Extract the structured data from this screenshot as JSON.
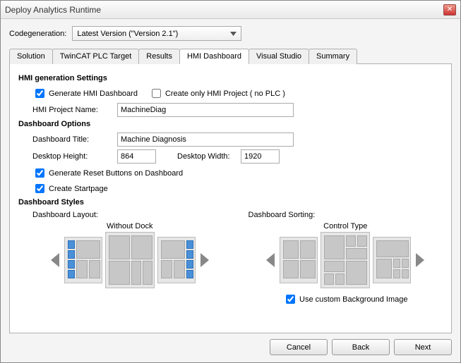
{
  "window": {
    "title": "Deploy Analytics Runtime"
  },
  "codegen": {
    "label": "Codegeneration:",
    "selected": "Latest Version (\"Version 2.1\")"
  },
  "tabs": {
    "items": [
      "Solution",
      "TwinCAT PLC Target",
      "Results",
      "HMI Dashboard",
      "Visual Studio",
      "Summary"
    ],
    "active_index": 3
  },
  "hmi_settings": {
    "heading": "HMI generation Settings",
    "generate_dashboard": {
      "label": "Generate HMI Dashboard",
      "checked": true
    },
    "create_only": {
      "label": "Create only HMI Project ( no PLC )",
      "checked": false
    },
    "project_name": {
      "label": "HMI Project Name:",
      "value": "MachineDiag"
    }
  },
  "dashboard_options": {
    "heading": "Dashboard Options",
    "title": {
      "label": "Dashboard Title:",
      "value": "Machine Diagnosis"
    },
    "height": {
      "label": "Desktop Height:",
      "value": "864"
    },
    "width": {
      "label": "Desktop Width:",
      "value": "1920"
    },
    "reset_buttons": {
      "label": "Generate Reset Buttons on Dashboard",
      "checked": true
    },
    "startpage": {
      "label": "Create Startpage",
      "checked": true
    }
  },
  "dashboard_styles": {
    "heading": "Dashboard Styles",
    "layout_label": "Dashboard Layout:",
    "layout_current": "Without Dock",
    "sorting_label": "Dashboard Sorting:",
    "sorting_current": "Control Type",
    "custom_bg": {
      "label": "Use custom Background Image",
      "checked": true
    }
  },
  "buttons": {
    "cancel": "Cancel",
    "back": "Back",
    "next": "Next"
  }
}
